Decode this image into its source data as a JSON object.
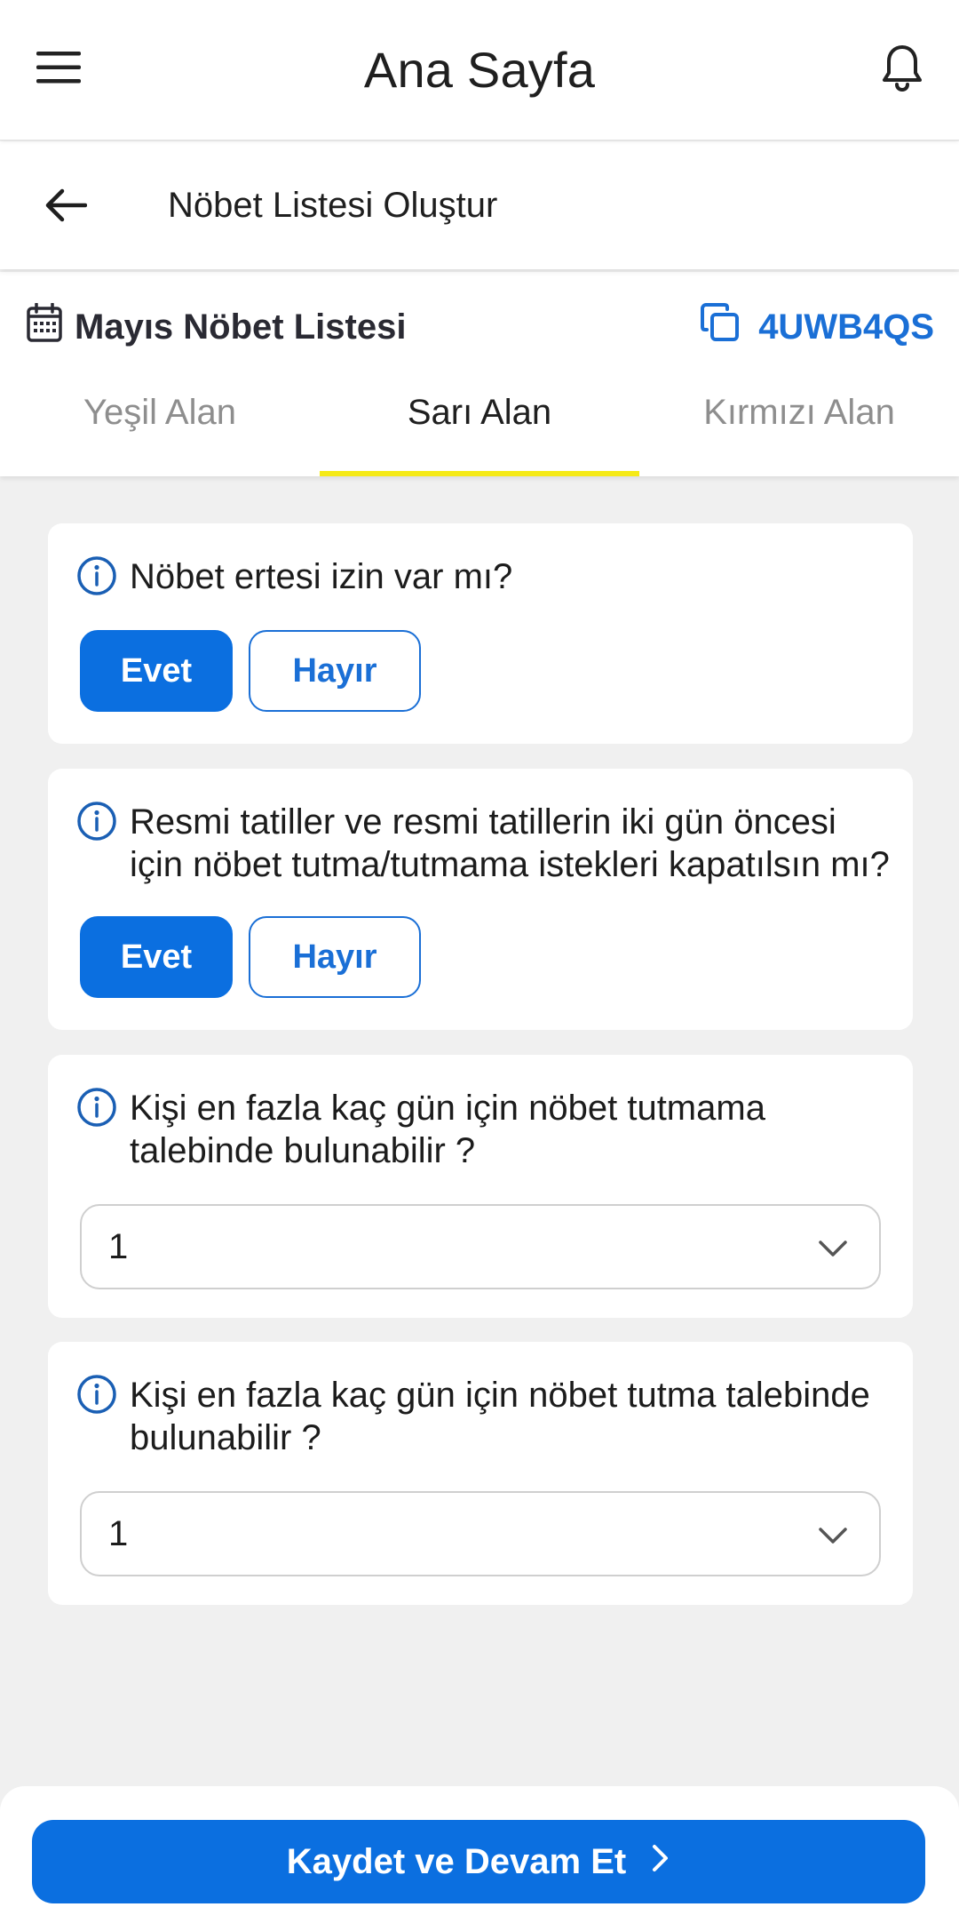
{
  "app_bar": {
    "title": "Ana Sayfa",
    "menu_icon": "hamburger-menu-icon",
    "bell_icon": "bell-icon"
  },
  "sub_header": {
    "title": "Nöbet Listesi Oluştur",
    "back_icon": "arrow-left-icon"
  },
  "list_info": {
    "name": "Mayıs Nöbet Listesi",
    "code": "4UWB4QS",
    "calendar_icon": "calendar-icon",
    "copy_icon": "copy-icon"
  },
  "tabs": [
    {
      "label": "Yeşil Alan",
      "active": false
    },
    {
      "label": "Sarı Alan",
      "active": true
    },
    {
      "label": "Kırmızı Alan",
      "active": false
    }
  ],
  "questions": [
    {
      "text": "Nöbet ertesi izin var mı?",
      "type": "yes_no",
      "yes_label": "Evet",
      "no_label": "Hayır",
      "selected": "Evet"
    },
    {
      "text": "Resmi tatiller ve resmi tatillerin iki gün öncesi için nöbet tutma/tutmama istekleri kapatılsın mı?",
      "type": "yes_no",
      "yes_label": "Evet",
      "no_label": "Hayır",
      "selected": "Evet"
    },
    {
      "text": "Kişi en fazla kaç gün için nöbet tutmama talebinde bulunabilir ?",
      "type": "select",
      "value": "1"
    },
    {
      "text": "Kişi en fazla kaç gün için nöbet tutma talebinde bulunabilir ?",
      "type": "select",
      "value": "1"
    }
  ],
  "footer": {
    "save_label": "Kaydet ve Devam Et",
    "chevron_icon": "chevron-right-icon"
  },
  "colors": {
    "primary": "#0b6fe0",
    "active_tab_indicator": "#f5ea17",
    "background": "#f0f0f0"
  }
}
